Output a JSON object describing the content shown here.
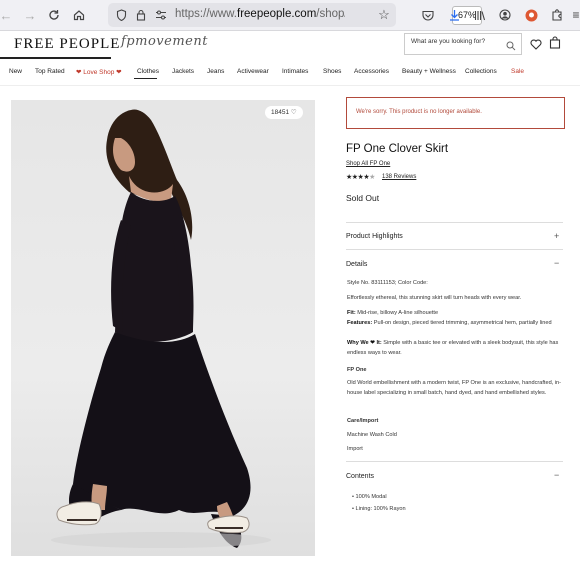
{
  "browser": {
    "url_prefix": "https://www.",
    "url_domain": "freepeople.com",
    "url_path": "/shop/fp",
    "zoom": "67%"
  },
  "site": {
    "brand": "FREE PEOPLE",
    "sub_brand": "fpmovement",
    "search_placeholder": "What are you looking for?"
  },
  "nav": [
    "New",
    "Top Rated",
    "Love Shop",
    "Clothes",
    "Jackets",
    "Jeans",
    "Activewear",
    "Intimates",
    "Shoes",
    "Accessories",
    "Beauty + Wellness",
    "Collections",
    "Sale"
  ],
  "colors": {
    "sale": "#c0392b",
    "alert": "#b24a3b",
    "heart": "#c0392b"
  },
  "product": {
    "likes": "18451",
    "alert": "We're sorry. This product is no longer available.",
    "title": "FP One Clover Skirt",
    "shop_all": "Shop All FP One",
    "rating": 4,
    "rating_max": 5,
    "reviews": "138 Reviews",
    "status": "Sold Out"
  },
  "sections": {
    "highlights": "Product Highlights",
    "details": "Details",
    "contents": "Contents"
  },
  "details": {
    "style_line": "Style No. 83111153; Color Code:",
    "description": "Effortlessly ethereal, this stunning skirt will turn heads with every wear.",
    "fit_label": "Fit:",
    "fit": "Mid-rise, billowy A-line silhouette",
    "features_label": "Features:",
    "features": "Pull-on design, pieced tiered trimming, asymmetrical hem, partially lined",
    "why_label": "Why We ❤ It:",
    "why": "Simple with a basic tee or elevated with a sleek bodysuit, this style has endless ways to wear.",
    "brand_heading": "FP One",
    "brand_text": "Old World embellishment with a modern twist, FP One is an exclusive, handcrafted, in-house label specializing in small batch, hand dyed, and hand embellished styles.",
    "care_heading": "Care/Import",
    "care": "Machine Wash Cold",
    "import": "Import"
  },
  "contents": [
    "100% Modal",
    "Lining: 100% Rayon"
  ]
}
